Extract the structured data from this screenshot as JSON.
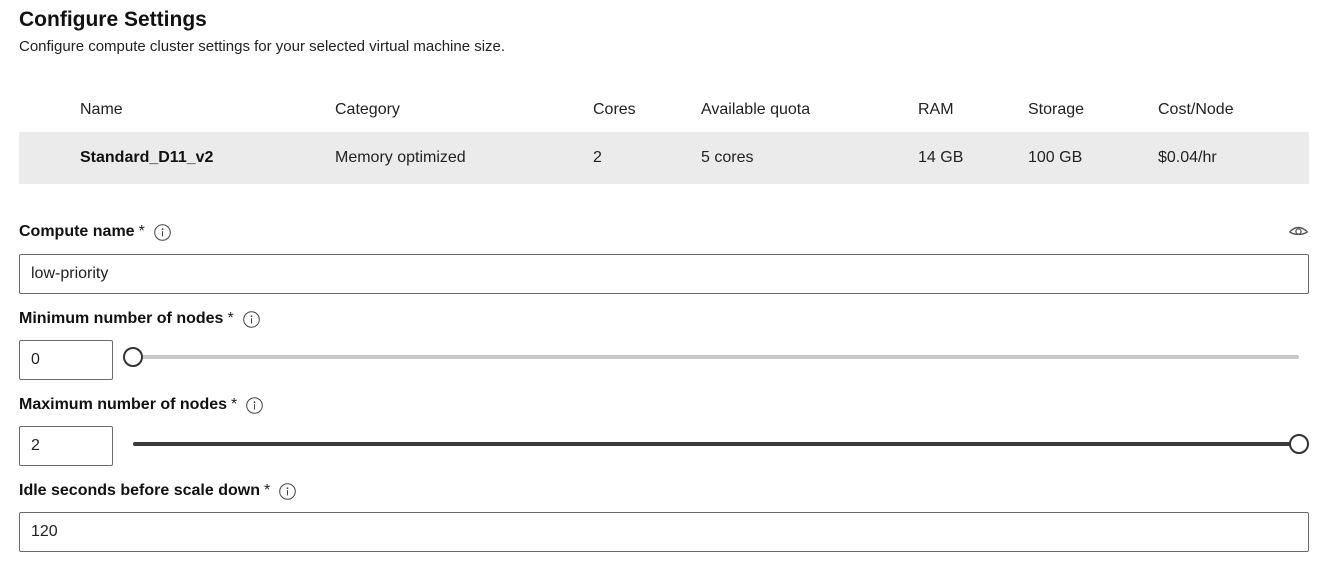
{
  "header": {
    "title": "Configure Settings",
    "subtitle": "Configure compute cluster settings for your selected virtual machine size."
  },
  "vm_table": {
    "columns": [
      "Name",
      "Category",
      "Cores",
      "Available quota",
      "RAM",
      "Storage",
      "Cost/Node"
    ],
    "row": {
      "name": "Standard_D11_v2",
      "category": "Memory optimized",
      "cores": "2",
      "quota": "5 cores",
      "ram": "14 GB",
      "storage": "100 GB",
      "cost": "$0.04/hr"
    }
  },
  "compute_name": {
    "label": "Compute name",
    "required": "*",
    "value": "low-priority"
  },
  "min_nodes": {
    "label": "Minimum number of nodes",
    "required": "*",
    "value": "0",
    "slider_fraction": 0
  },
  "max_nodes": {
    "label": "Maximum number of nodes",
    "required": "*",
    "value": "2",
    "slider_fraction": 1
  },
  "idle_seconds": {
    "label": "Idle seconds before scale down",
    "required": "*",
    "value": "120"
  },
  "icons": {
    "info": "info-icon",
    "visibility": "eye-icon"
  }
}
